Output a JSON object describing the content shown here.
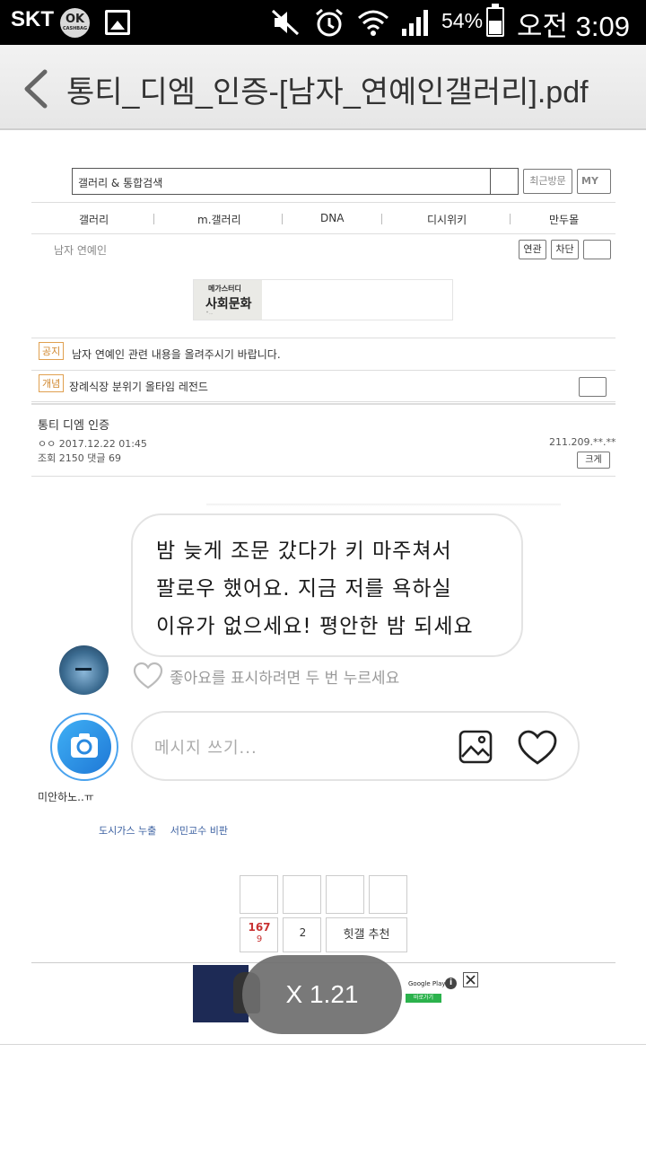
{
  "status_bar": {
    "carrier": "SKT",
    "ok_badge": "OK",
    "ok_badge_sub": "CASHBAG",
    "battery": "54%",
    "time": "오전 3:09"
  },
  "title_bar": {
    "title": "통티_디엠_인증-[남자_연예인갤러리].pdf"
  },
  "site": {
    "search_text": "갤러리 & 통합검색",
    "recent_button": "최근방문",
    "my_button": "MY",
    "nav": [
      "갤러리",
      "m.갤러리",
      "DNA",
      "디시위키",
      "만두몰"
    ],
    "gallery_name": "남자 연예인",
    "related_button": "연관",
    "block_button": "차단",
    "banner_line1": "메가스터디",
    "banner_line2": "사회문화",
    "notice_tag": "공지",
    "notice_text": "남자 연예인 관련 내용을 올려주시기 바랍니다.",
    "concept_tag": "개념",
    "concept_text": "장례식장 분위기 올타임 레전드"
  },
  "post": {
    "title": "통티 디엠 인증",
    "author_date": "ㅇㅇ 2017.12.22 01:45",
    "stats": "조회 2150  댓글  69",
    "ip": "211.209.**.**",
    "size_button": "크게"
  },
  "dm": {
    "message_lines": [
      "밤 늦게 조문 갔다가 키 마주쳐서",
      "팔로우 했어요. 지금 저를 욕하실",
      "이유가 없으세요! 평안한 밤 되세요"
    ],
    "like_hint": "좋아요를 표시하려면 두 번 누르세요",
    "input_placeholder": "메시지 쓰기...",
    "caption": "미안하노..ㅠ"
  },
  "links": [
    "도시가스 누출",
    "서민교수 비판"
  ],
  "votes": {
    "up_count": "167",
    "up_sub": "9",
    "down_count": "2",
    "hit_button": "힛갤 추천"
  },
  "ad": {
    "store": "Google Play",
    "cta": "바로가기",
    "info": "i"
  },
  "zoom_level": "X 1.21",
  "icons": [
    "back-icon",
    "mute-icon",
    "alarm-icon",
    "wifi-icon",
    "signal-icon",
    "heart-icon",
    "camera-icon",
    "image-icon",
    "close-icon"
  ]
}
